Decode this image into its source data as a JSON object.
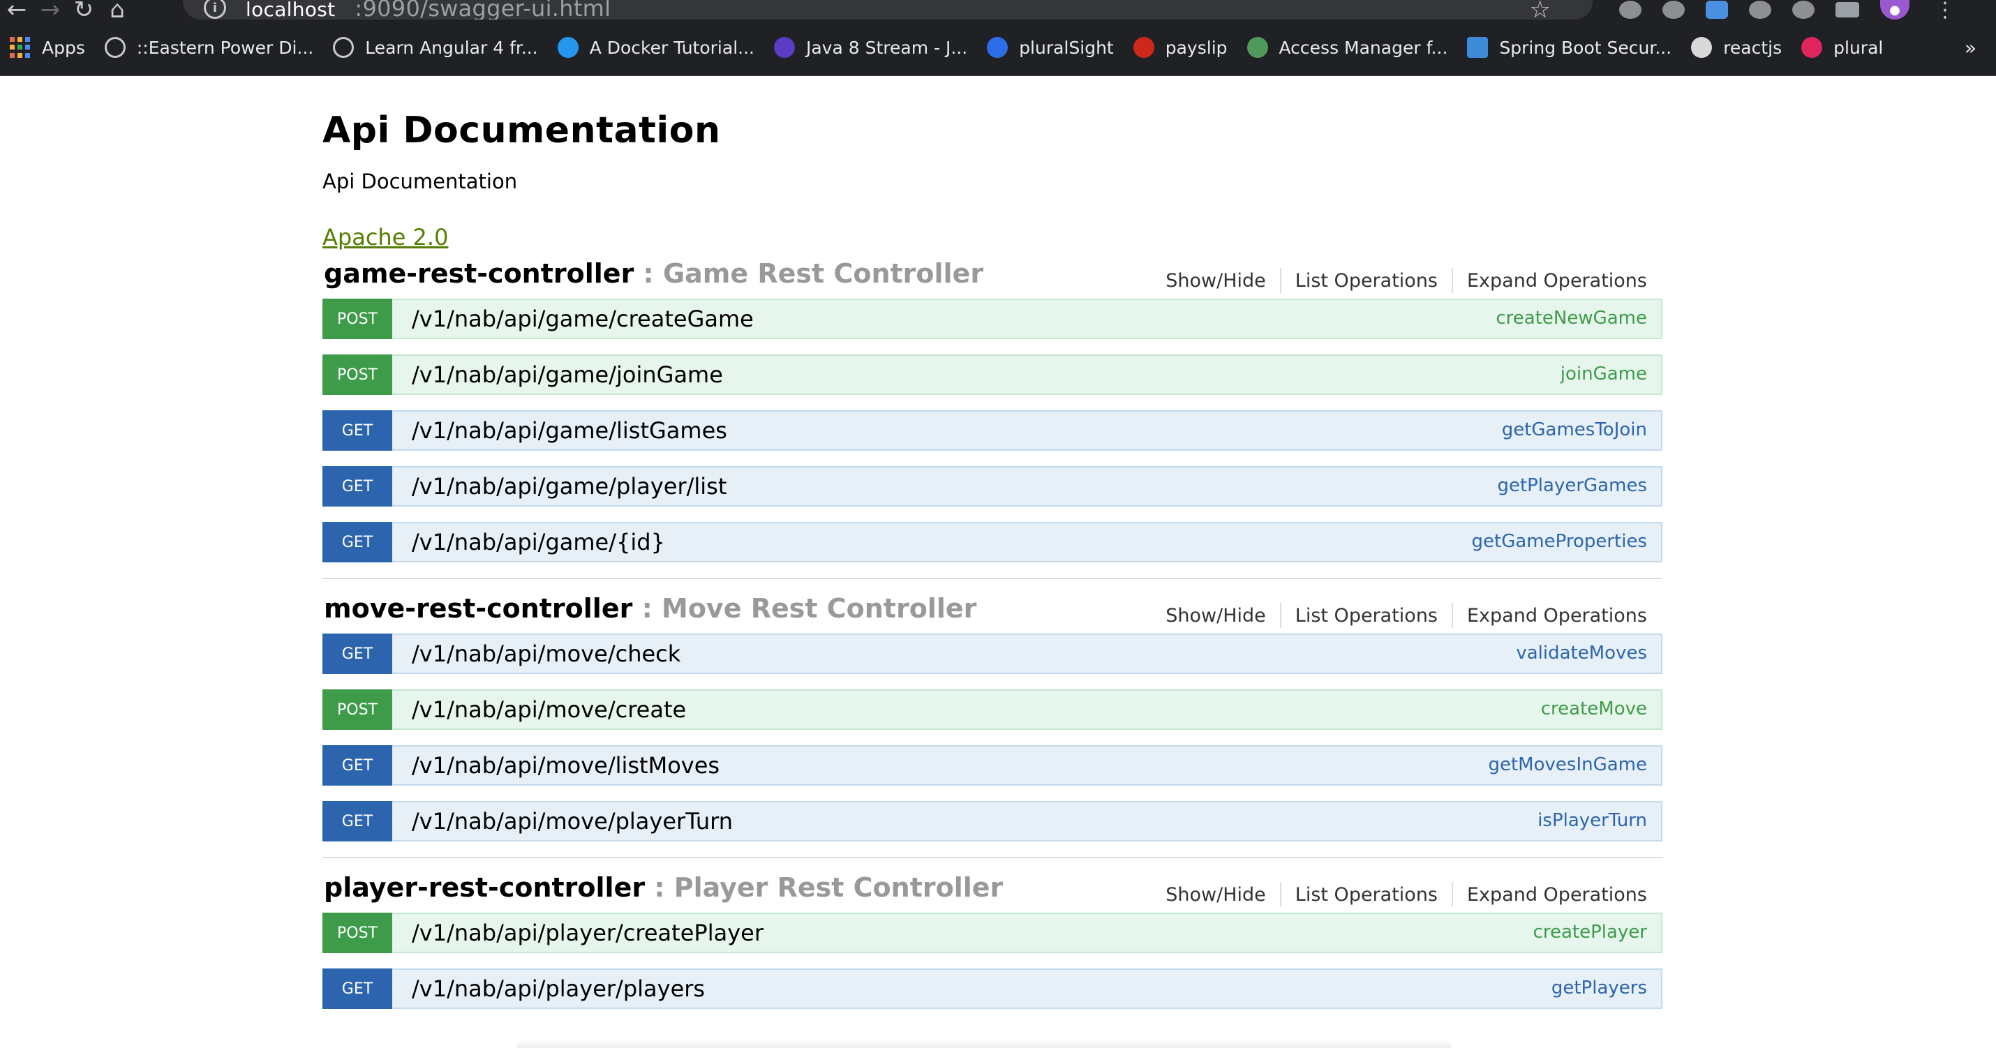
{
  "browser": {
    "url_host": "localhost",
    "url_path": ":9090/swagger-ui.html",
    "bookmarks": [
      {
        "label": "Apps",
        "icon": "apps-grid-icon",
        "color": "#e06b4e"
      },
      {
        "label": "::Eastern Power Di...",
        "icon": "globe-icon",
        "color": "#c8c9cc"
      },
      {
        "label": "Learn Angular 4 fr...",
        "icon": "globe-icon",
        "color": "#c8c9cc"
      },
      {
        "label": "A Docker Tutorial...",
        "icon": "docker-icon",
        "color": "#2496ed"
      },
      {
        "label": "Java 8 Stream - J...",
        "icon": "jd-icon",
        "color": "#5b3cc4"
      },
      {
        "label": "pluralSight",
        "icon": "pluralsight-c-icon",
        "color": "#2b6ee8"
      },
      {
        "label": "payslip",
        "icon": "adp-icon",
        "color": "#d0271d"
      },
      {
        "label": "Access Manager f...",
        "icon": "access-manager-icon",
        "color": "#4f9a5b"
      },
      {
        "label": "Spring Boot Secur...",
        "icon": "j-icon",
        "color": "#3d8bd8"
      },
      {
        "label": "reactjs",
        "icon": "ninja-icon",
        "color": "#d9d9d9"
      },
      {
        "label": "plural",
        "icon": "plural-play-icon",
        "color": "#e0245e"
      }
    ],
    "more": "»"
  },
  "page": {
    "title": "Api Documentation",
    "subtitle": "Api Documentation",
    "license": "Apache 2.0"
  },
  "links": {
    "show_hide": "Show/Hide",
    "list_ops": "List Operations",
    "expand_ops": "Expand Operations"
  },
  "resources": [
    {
      "name": "game-rest-controller",
      "desc": " : Game Rest Controller",
      "ops": [
        {
          "method": "POST",
          "path": "/v1/nab/api/game/createGame",
          "id": "createNewGame"
        },
        {
          "method": "POST",
          "path": "/v1/nab/api/game/joinGame",
          "id": "joinGame"
        },
        {
          "method": "GET",
          "path": "/v1/nab/api/game/listGames",
          "id": "getGamesToJoin"
        },
        {
          "method": "GET",
          "path": "/v1/nab/api/game/player/list",
          "id": "getPlayerGames"
        },
        {
          "method": "GET",
          "path": "/v1/nab/api/game/{id}",
          "id": "getGameProperties"
        }
      ]
    },
    {
      "name": "move-rest-controller",
      "desc": " : Move Rest Controller",
      "ops": [
        {
          "method": "GET",
          "path": "/v1/nab/api/move/check",
          "id": "validateMoves"
        },
        {
          "method": "POST",
          "path": "/v1/nab/api/move/create",
          "id": "createMove"
        },
        {
          "method": "GET",
          "path": "/v1/nab/api/move/listMoves",
          "id": "getMovesInGame"
        },
        {
          "method": "GET",
          "path": "/v1/nab/api/move/playerTurn",
          "id": "isPlayerTurn"
        }
      ]
    },
    {
      "name": "player-rest-controller",
      "desc": " : Player Rest Controller",
      "ops": [
        {
          "method": "POST",
          "path": "/v1/nab/api/player/createPlayer",
          "id": "createPlayer"
        },
        {
          "method": "GET",
          "path": "/v1/nab/api/player/players",
          "id": "getPlayers"
        }
      ]
    }
  ]
}
